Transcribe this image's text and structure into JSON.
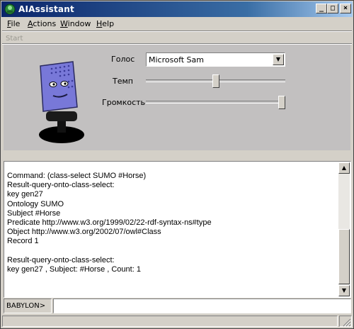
{
  "window": {
    "title": "AIAssistant"
  },
  "title_buttons": {
    "minimize": "_",
    "maximize": "□",
    "close": "×"
  },
  "menu": [
    {
      "label": "File",
      "mnemonic": "F",
      "rest": "ile"
    },
    {
      "label": "Actions",
      "mnemonic": "A",
      "rest": "ctions"
    },
    {
      "label": "Window",
      "mnemonic": "W",
      "rest": "indow"
    },
    {
      "label": "Help",
      "mnemonic": "H",
      "rest": "elp"
    }
  ],
  "toolbar": {
    "start_label": "Start"
  },
  "voice_panel": {
    "voice_label": "Голос",
    "voice_value": "Microsoft Sam",
    "rate_label": "Темп",
    "rate_level": 0.5,
    "volume_label": "Громкость",
    "volume_level": 1.0
  },
  "console": {
    "lines": [
      "Command: (class-select SUMO #Horse)",
      "Result-query-onto-class-select:",
      "key gen27",
      "Ontology SUMO",
      "Subject #Horse",
      "Predicate http://www.w3.org/1999/02/22-rdf-syntax-ns#type",
      "Object http://www.w3.org/2002/07/owl#Class",
      "Record 1",
      "",
      "Result-query-onto-class-select:",
      "key gen27 , Subject: #Horse , Count: 1"
    ]
  },
  "input": {
    "prompt": "BABYLON>",
    "value": ""
  },
  "colors": {
    "title_gradient_start": "#0a246a",
    "title_gradient_end": "#a6caf0",
    "face": "#d4d0c8",
    "panel": "#c2c0c0",
    "mic_head": "#7878d8"
  }
}
